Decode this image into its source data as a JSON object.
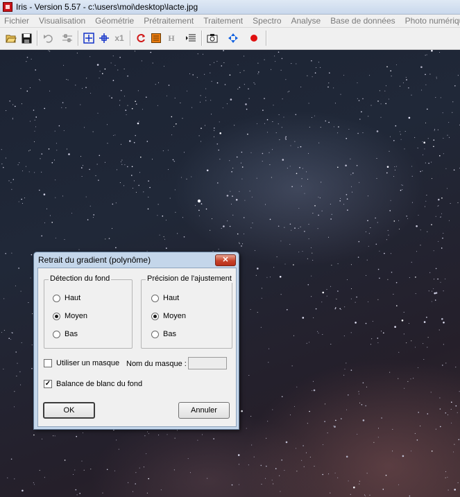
{
  "window": {
    "title": "Iris - Version 5.57 - c:\\users\\moi\\desktop\\lacte.jpg"
  },
  "menu": [
    "Fichier",
    "Visualisation",
    "Géométrie",
    "Prétraitement",
    "Traitement",
    "Spectro",
    "Analyse",
    "Base de données",
    "Photo numérique"
  ],
  "toolbar": {
    "buttons": [
      {
        "name": "open-icon"
      },
      {
        "name": "save-icon"
      },
      {
        "name": "undo-icon"
      },
      {
        "name": "threshold-icon"
      },
      {
        "name": "zoom-in-icon"
      },
      {
        "name": "zoom-move-icon"
      },
      {
        "name": "x1",
        "label": "x1"
      },
      {
        "name": "rotate-icon"
      },
      {
        "name": "palette-icon"
      },
      {
        "name": "header",
        "label": "H"
      },
      {
        "name": "list-icon"
      },
      {
        "name": "camera-icon"
      },
      {
        "name": "pan-icon"
      },
      {
        "name": "record-icon"
      }
    ]
  },
  "dialog": {
    "title": "Retrait du gradient (polynôme)",
    "close_label": "✕",
    "group_detection": {
      "legend": "Détection du fond",
      "options": [
        "Haut",
        "Moyen",
        "Bas"
      ],
      "selected": "Moyen"
    },
    "group_precision": {
      "legend": "Précision de l'ajustement",
      "options": [
        "Haut",
        "Moyen",
        "Bas"
      ],
      "selected": "Moyen"
    },
    "use_mask_label": "Utiliser un masque",
    "use_mask_checked": false,
    "mask_name_label": "Nom du masque :",
    "mask_name_value": "",
    "white_balance_label": "Balance de blanc du fond",
    "white_balance_checked": true,
    "ok_label": "OK",
    "cancel_label": "Annuler"
  }
}
